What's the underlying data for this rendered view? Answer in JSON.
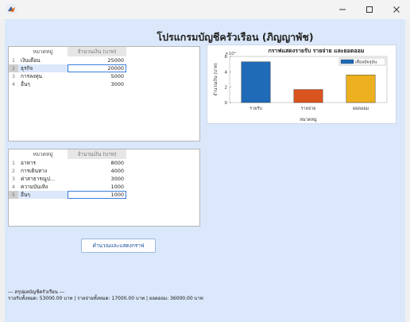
{
  "window": {
    "title": ""
  },
  "title": "โปรแกรมบัญชีครัวเรือน (ภิญญาพัช)",
  "income_table": {
    "headers": [
      "",
      "หมวดหมู่",
      "จำนวนเงิน (บาท)"
    ],
    "rows": [
      {
        "n": "1",
        "category": "เงินเดือน",
        "amount": "25000"
      },
      {
        "n": "2",
        "category": "ธุรกิจ",
        "amount": "20000"
      },
      {
        "n": "3",
        "category": "การลงทุน",
        "amount": "5000"
      },
      {
        "n": "4",
        "category": "อื่นๆ",
        "amount": "3000"
      }
    ]
  },
  "expense_table": {
    "headers": [
      "",
      "หมวดหมู่",
      "จำนวนเงิน (บาท)"
    ],
    "rows": [
      {
        "n": "1",
        "category": "อาหาร",
        "amount": "8000"
      },
      {
        "n": "2",
        "category": "การเดินทาง",
        "amount": "4000"
      },
      {
        "n": "3",
        "category": "ค่าสาธารณูป...",
        "amount": "3000"
      },
      {
        "n": "4",
        "category": "ความบันเทิง",
        "amount": "1000"
      },
      {
        "n": "5",
        "category": "อื่นๆ",
        "amount": "1000"
      }
    ]
  },
  "calc_button": "คำนวณและแสดงกราฟ",
  "summary": {
    "line1": "--- สรุปผลบัญชีครัวเรือน ---",
    "line2": "รายรับทั้งหมด: 53000.00 บาท | รายจ่ายทั้งหมด: 17000.00 บาท | ยอดออม: 36000.00 บาท"
  },
  "colors": {
    "bar_income": "#1f6bb8",
    "bar_expense": "#d9541e",
    "bar_savings": "#edb120"
  },
  "chart_data": {
    "type": "bar",
    "title": "กราฟแสดงรายรับ รายจ่าย และยอดออม",
    "xlabel": "หมวดหมู่",
    "ylabel": "จำนวนเงิน (บาท)",
    "exponent": "×10⁴",
    "categories": [
      "รายรับ",
      "รายจ่าย",
      "ยอดออม"
    ],
    "values": [
      53000,
      17000,
      36000
    ],
    "ylim": [
      0,
      60000
    ],
    "yticks": [
      "0",
      "2",
      "4",
      "6"
    ],
    "legend": {
      "label": "เดือนปัจจุบัน",
      "position": "top-right"
    }
  }
}
